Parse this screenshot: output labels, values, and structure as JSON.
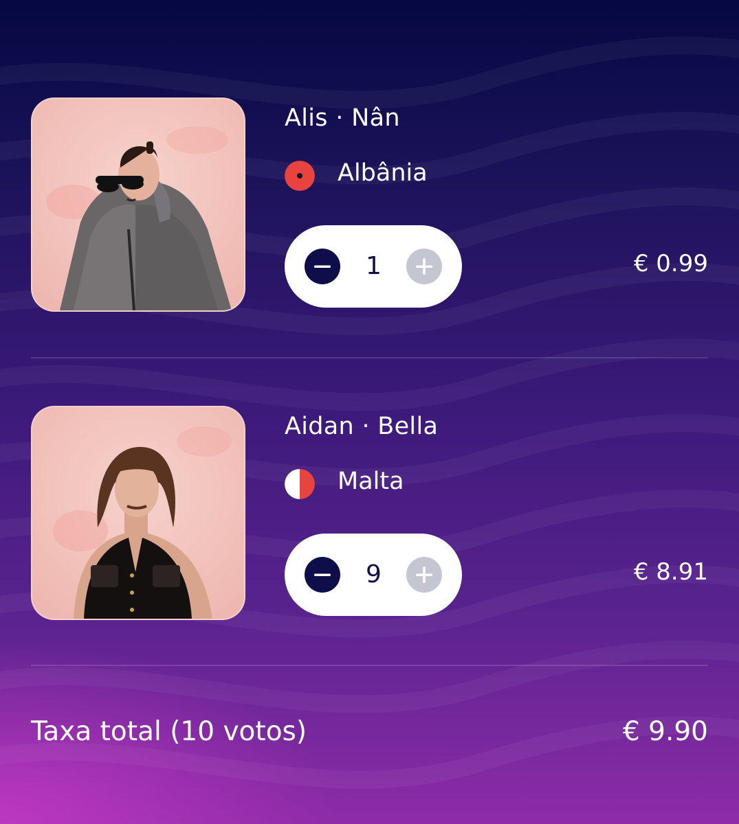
{
  "colors": {
    "accent_dark": "#0d0e4a",
    "button_disabled": "#c4c6d2",
    "text": "#ffffff",
    "albania_flag": "#e8433e",
    "malta_flag": "#e8433e"
  },
  "items": [
    {
      "artist": "Alis",
      "song": "Nân",
      "artist_song": "Alis · Nân",
      "country": "Albânia",
      "flag_icon": "albania-flag-icon",
      "quantity": "1",
      "price": "€ 0.99",
      "minus_icon": "minus-icon",
      "plus_icon": "plus-icon"
    },
    {
      "artist": "Aidan",
      "song": "Bella",
      "artist_song": "Aidan · Bella",
      "country": "Malta",
      "flag_icon": "malta-flag-icon",
      "quantity": "9",
      "price": "€ 8.91",
      "minus_icon": "minus-icon",
      "plus_icon": "plus-icon"
    }
  ],
  "summary": {
    "label": "Taxa total (10 votos)",
    "total": "€ 9.90"
  }
}
